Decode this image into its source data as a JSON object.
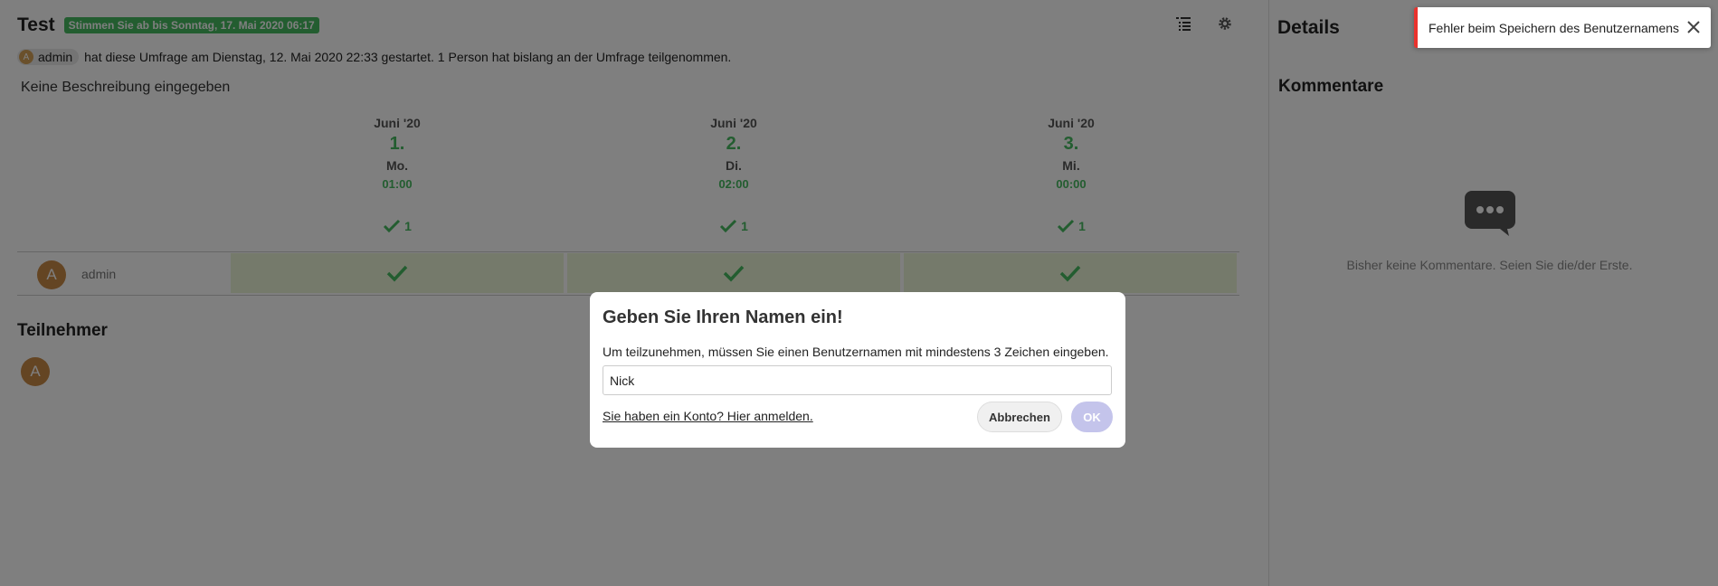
{
  "poll": {
    "title": "Test",
    "expire_badge": "Stimmen Sie ab bis Sonntag, 17. Mai 2020 06:17",
    "owner": "admin",
    "owner_initial": "A",
    "meta_text": "hat diese Umfrage am Dienstag, 12. Mai 2020 22:33 gestartet. 1 Person hat bislang an der Umfrage teilgenommen.",
    "description": "Keine Beschreibung eingegeben"
  },
  "toolbar": {
    "list_icon": "list-view-icon",
    "settings_icon": "gear-icon"
  },
  "options": [
    {
      "month": "Juni '20",
      "day": "1.",
      "dow": "Mo.",
      "time": "01:00",
      "yes_count": "1"
    },
    {
      "month": "Juni '20",
      "day": "2.",
      "dow": "Di.",
      "time": "02:00",
      "yes_count": "1"
    },
    {
      "month": "Juni '20",
      "day": "3.",
      "dow": "Mi.",
      "time": "00:00",
      "yes_count": "1"
    }
  ],
  "votes": [
    {
      "user": "admin",
      "initial": "A",
      "answers": [
        "yes",
        "yes",
        "yes"
      ]
    }
  ],
  "participants": {
    "title": "Teilnehmer",
    "list": [
      {
        "initial": "A"
      }
    ]
  },
  "sidebar": {
    "title": "Details",
    "comments_title": "Kommentare",
    "empty_text": "Bisher keine Kommentare. Seien Sie die/der Erste."
  },
  "dialog": {
    "title": "Geben Sie Ihren Namen ein!",
    "text": "Um teilzunehmen, müssen Sie einen Benutzernamen mit mindestens 3 Zeichen eingeben.",
    "input_value": "Nick",
    "login_link": "Sie haben ein Konto? Hier anmelden.",
    "cancel_label": "Abbrechen",
    "ok_label": "OK"
  },
  "toast": {
    "text": "Fehler beim Speichern des Benutzernamens"
  },
  "colors": {
    "accent_green": "#46ba61",
    "vote_yes_bg": "#ebf5d6",
    "error_red": "#e9322d",
    "ok_disabled": "#c4c4eb",
    "avatar": "#c98a46"
  }
}
